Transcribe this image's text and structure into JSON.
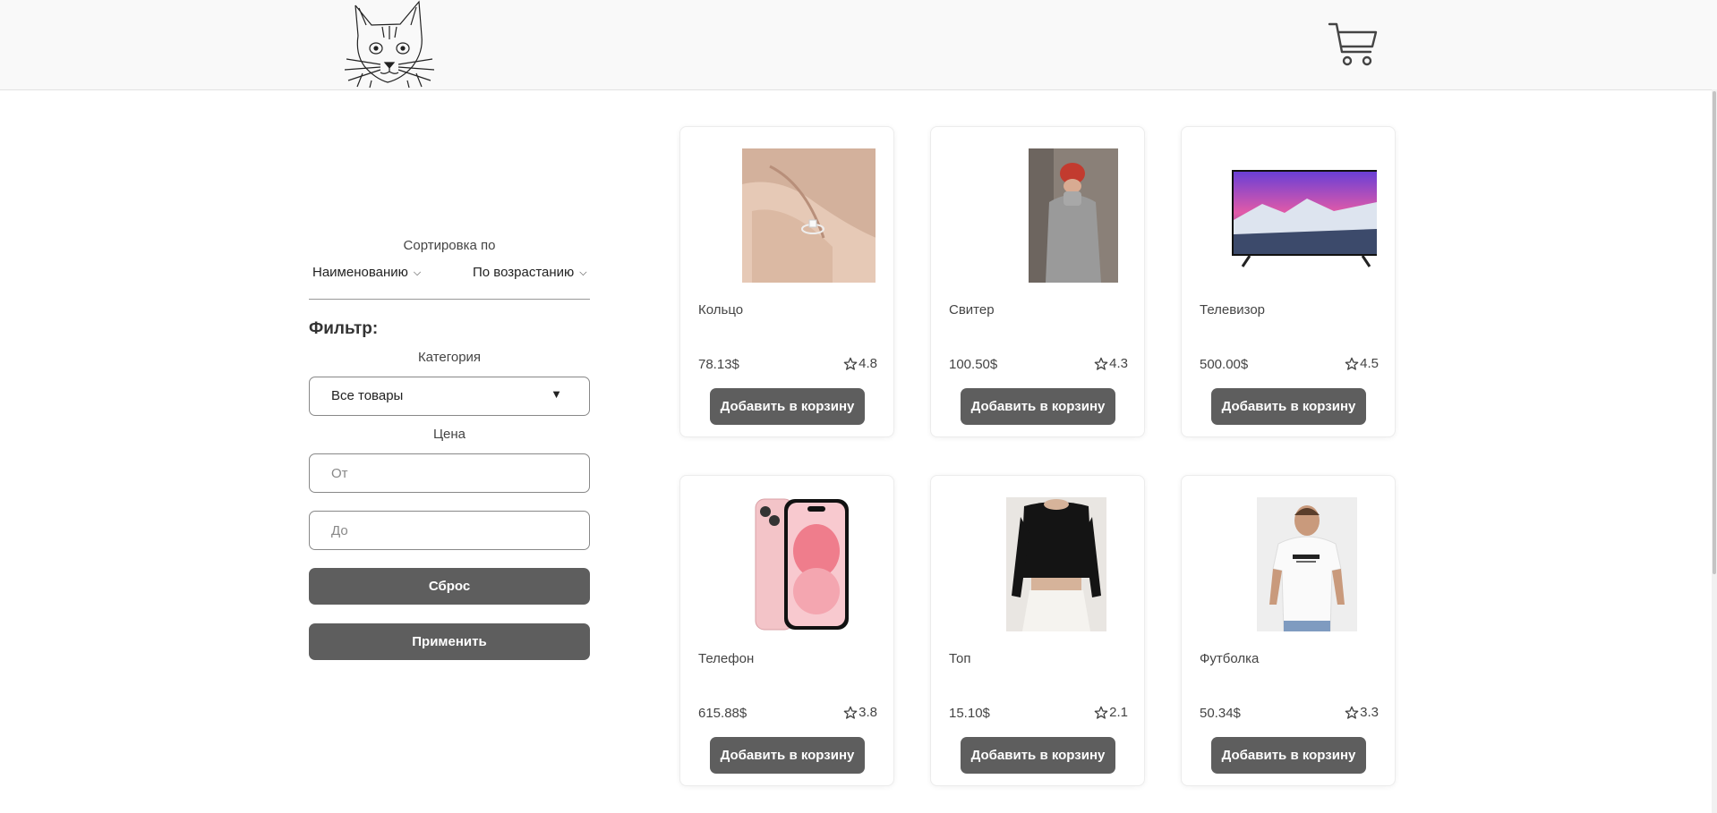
{
  "header": {
    "logo_icon": "cat-logo",
    "cart_icon": "cart-icon"
  },
  "sidebar": {
    "sort_title": "Сортировка по",
    "sort_by": "Наименованию",
    "sort_order": "По возрастанию",
    "filter_title": "Фильтр:",
    "category_label": "Категория",
    "category_value": "Все товары",
    "price_label": "Цена",
    "price_from_placeholder": "От",
    "price_to_placeholder": "До",
    "reset_label": "Сброс",
    "apply_label": "Применить"
  },
  "products": [
    {
      "title": "Кольцо",
      "price": "78.13$",
      "rating": "4.8",
      "button": "Добавить в корзину"
    },
    {
      "title": "Свитер",
      "price": "100.50$",
      "rating": "4.3",
      "button": "Добавить в корзину"
    },
    {
      "title": "Телевизор",
      "price": "500.00$",
      "rating": "4.5",
      "button": "Добавить в корзину"
    },
    {
      "title": "Телефон",
      "price": "615.88$",
      "rating": "3.8",
      "button": "Добавить в корзину"
    },
    {
      "title": "Топ",
      "price": "15.10$",
      "rating": "2.1",
      "button": "Добавить в корзину"
    },
    {
      "title": "Футболка",
      "price": "50.34$",
      "rating": "3.3",
      "button": "Добавить в корзину"
    }
  ],
  "colors": {
    "button_bg": "#5e5e5e",
    "header_bg": "#f9f9f9"
  }
}
